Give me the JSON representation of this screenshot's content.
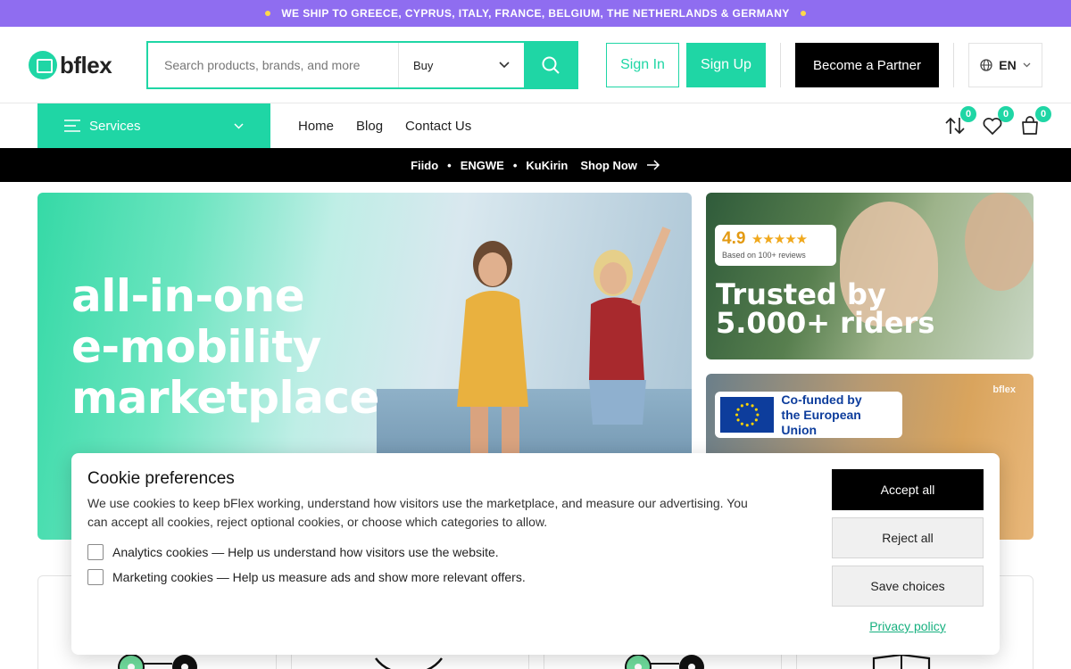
{
  "announcement": {
    "text": "WE SHIP TO GREECE, CYPRUS, ITALY, FRANCE, BELGIUM, THE NETHERLANDS & GERMANY"
  },
  "header": {
    "logo_text": "bflex",
    "search": {
      "placeholder": "Search products, brands, and more",
      "mode_selected": "Buy"
    },
    "sign_in": "Sign In",
    "sign_up": "Sign Up",
    "partner": "Become a Partner",
    "language": "EN"
  },
  "nav": {
    "services_label": "Services",
    "links": [
      "Home",
      "Blog",
      "Contact Us"
    ],
    "counts": {
      "compare": "0",
      "wishlist": "0",
      "cart": "0"
    }
  },
  "brand_strip": {
    "brands": [
      "Fiido",
      "ENGWE",
      "KuKirin"
    ],
    "separator": "•",
    "cta": "Shop Now"
  },
  "hero": {
    "title_lines": [
      "all-in-one",
      "e-mobility",
      "marketplace"
    ]
  },
  "promo_trust": {
    "score": "4.9",
    "stars": "★★★★★",
    "reviews": "Based on 100+ reviews",
    "title_lines": [
      "Trusted by",
      "5.000+ riders"
    ]
  },
  "promo_eu": {
    "text_lines": [
      "Co-funded by",
      "the European Union"
    ],
    "brandmark": "bflex"
  },
  "cookie": {
    "title": "Cookie preferences",
    "description": "We use cookies to keep bFlex working, understand how visitors use the marketplace, and measure our advertising. You can accept all cookies, reject optional cookies, or choose which categories to allow.",
    "options": [
      {
        "label": "Analytics cookies — Help us understand how visitors use the website.",
        "checked": false
      },
      {
        "label": "Marketing cookies — Help us measure ads and show more relevant offers.",
        "checked": false
      }
    ],
    "accept_all": "Accept all",
    "reject_all": "Reject all",
    "save_choices": "Save choices",
    "privacy_link": "Privacy policy"
  },
  "colors": {
    "accent": "#1fd6a5",
    "announcement_bg": "#8f6df0",
    "dark": "#000000"
  }
}
